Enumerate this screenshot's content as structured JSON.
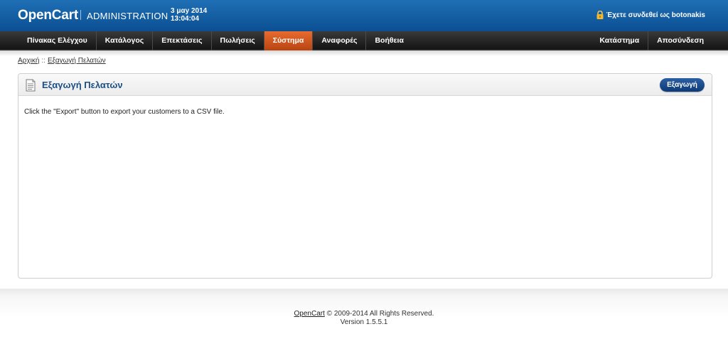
{
  "header": {
    "logo": "OpenCart",
    "admin_label": "ADMINISTRATION",
    "date": "3 μαy 2014",
    "time": "13:04:04",
    "login_text": "Έχετε συνδεθεί ως botonakis",
    "login_icon": "lock-icon"
  },
  "menu": {
    "left": [
      {
        "label": "Πίνακας Ελέγχου"
      },
      {
        "label": "Κατάλογος"
      },
      {
        "label": "Επεκτάσεις"
      },
      {
        "label": "Πωλήσεις"
      },
      {
        "label": "Σύστημα",
        "active": true
      },
      {
        "label": "Αναφορές"
      },
      {
        "label": "Βοήθεια"
      }
    ],
    "right": [
      {
        "label": "Κατάστημα"
      },
      {
        "label": "Αποσύνδεση"
      }
    ],
    "active_color": "#d9581f"
  },
  "breadcrumb": {
    "items": [
      "Αρχική",
      "Εξαγωγή Πελατών"
    ],
    "separator": "::"
  },
  "box": {
    "title": "Εξαγωγή Πελατών",
    "icon": "document-icon",
    "export_button": "Εξαγωγή",
    "content": "Click the \"Export\" button to export your customers to a CSV file."
  },
  "footer": {
    "link": "OpenCart",
    "copyright": " © 2009-2014 All Rights Reserved.",
    "version": "Version 1.5.5.1"
  }
}
